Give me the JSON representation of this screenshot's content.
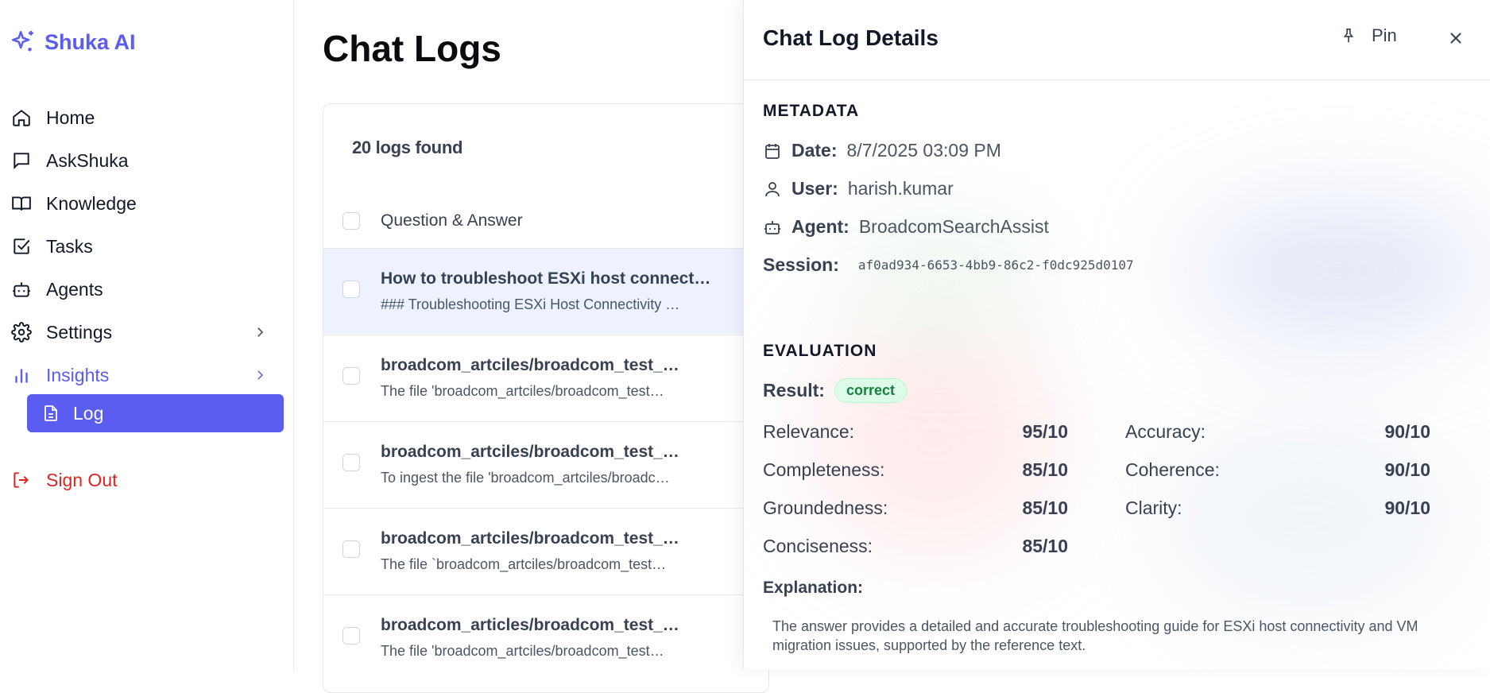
{
  "brand": {
    "name": "Shuka AI",
    "icon": "sparkles-icon",
    "accent": "#5b5cf0"
  },
  "sidebar": {
    "items": [
      {
        "label": "Home",
        "icon": "home-icon"
      },
      {
        "label": "AskShuka",
        "icon": "chat-icon"
      },
      {
        "label": "Knowledge",
        "icon": "book-icon"
      },
      {
        "label": "Tasks",
        "icon": "checkbox-icon"
      },
      {
        "label": "Agents",
        "icon": "bot-icon"
      },
      {
        "label": "Settings",
        "icon": "gear-icon"
      },
      {
        "label": "Insights",
        "icon": "bar-chart-icon"
      }
    ],
    "sub_item": {
      "label": "Log",
      "icon": "document-icon"
    },
    "signout": {
      "label": "Sign Out",
      "icon": "logout-icon"
    }
  },
  "main": {
    "title": "Chat Logs",
    "count": "20 logs found",
    "column_header": "Question & Answer",
    "rows": [
      {
        "q": "How to troubleshoot ESXi host connect…",
        "a": "### Troubleshooting ESXi Host Connectivity …"
      },
      {
        "q": "broadcom_artciles/broadcom_test_…",
        "a": "The file 'broadcom_artciles/broadcom_test…"
      },
      {
        "q": "broadcom_artciles/broadcom_test_…",
        "a": "To ingest the file 'broadcom_artciles/broadc…"
      },
      {
        "q": "broadcom_artciles/broadcom_test_…",
        "a": "The file `broadcom_artciles/broadcom_test…"
      },
      {
        "q": "broadcom_articles/broadcom_test_…",
        "a": "The file 'broadcom_artciles/broadcom_test…"
      }
    ]
  },
  "panel": {
    "title": "Chat Log Details",
    "pin_label": "Pin",
    "metadata_label": "METADATA",
    "date_key": "Date:",
    "date_val": "8/7/2025 03:09 PM",
    "user_key": "User:",
    "user_val": "harish.kumar",
    "agent_key": "Agent:",
    "agent_val": "BroadcomSearchAssist",
    "session_key": "Session:",
    "session_val": "af0ad934-6653-4bb9-86c2-f0dc925d0107",
    "evaluation_label": "EVALUATION",
    "result_key": "Result:",
    "result_val": "correct",
    "metrics": {
      "relevance_k": "Relevance:",
      "relevance_v": "95/10",
      "accuracy_k": "Accuracy:",
      "accuracy_v": "90/10",
      "completeness_k": "Completeness:",
      "completeness_v": "85/10",
      "coherence_k": "Coherence:",
      "coherence_v": "90/10",
      "groundedness_k": "Groundedness:",
      "groundedness_v": "85/10",
      "clarity_k": "Clarity:",
      "clarity_v": "90/10",
      "conciseness_k": "Conciseness:",
      "conciseness_v": "85/10"
    },
    "explanation_label": "Explanation:",
    "explanation_text": "The answer provides a detailed and accurate troubleshooting guide for ESXi host connectivity and VM migration issues, supported by the reference text."
  }
}
